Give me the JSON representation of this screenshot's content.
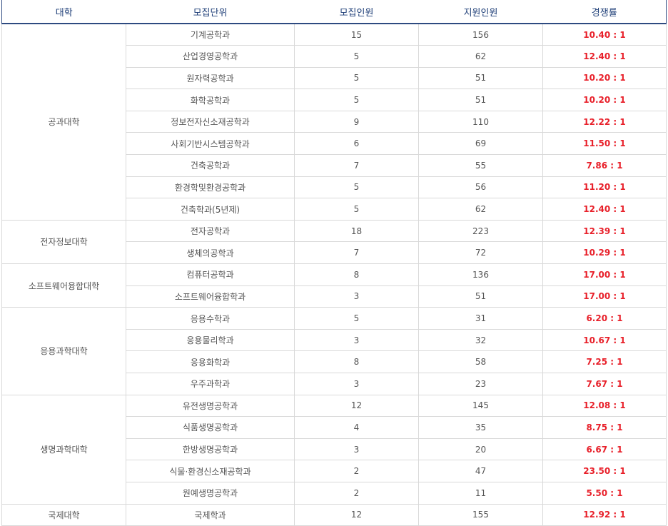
{
  "headers": {
    "college": "대학",
    "unit": "모집단위",
    "quota": "모집인원",
    "applicants": "지원인원",
    "ratio": "경쟁률"
  },
  "colleges": [
    {
      "name": "공과대학",
      "rows": [
        {
          "unit": "기계공학과",
          "quota": "15",
          "applicants": "156",
          "ratio": "10.40 : 1"
        },
        {
          "unit": "산업경영공학과",
          "quota": "5",
          "applicants": "62",
          "ratio": "12.40 : 1"
        },
        {
          "unit": "원자력공학과",
          "quota": "5",
          "applicants": "51",
          "ratio": "10.20 : 1"
        },
        {
          "unit": "화학공학과",
          "quota": "5",
          "applicants": "51",
          "ratio": "10.20 : 1"
        },
        {
          "unit": "정보전자신소재공학과",
          "quota": "9",
          "applicants": "110",
          "ratio": "12.22 : 1"
        },
        {
          "unit": "사회기반시스템공학과",
          "quota": "6",
          "applicants": "69",
          "ratio": "11.50 : 1"
        },
        {
          "unit": "건축공학과",
          "quota": "7",
          "applicants": "55",
          "ratio": "7.86 : 1"
        },
        {
          "unit": "환경학및환경공학과",
          "quota": "5",
          "applicants": "56",
          "ratio": "11.20 : 1"
        },
        {
          "unit": "건축학과(5년제)",
          "quota": "5",
          "applicants": "62",
          "ratio": "12.40 : 1"
        }
      ]
    },
    {
      "name": "전자정보대학",
      "rows": [
        {
          "unit": "전자공학과",
          "quota": "18",
          "applicants": "223",
          "ratio": "12.39 : 1"
        },
        {
          "unit": "생체의공학과",
          "quota": "7",
          "applicants": "72",
          "ratio": "10.29 : 1"
        }
      ]
    },
    {
      "name": "소프트웨어융합대학",
      "rows": [
        {
          "unit": "컴퓨터공학과",
          "quota": "8",
          "applicants": "136",
          "ratio": "17.00 : 1"
        },
        {
          "unit": "소프트웨어융합학과",
          "quota": "3",
          "applicants": "51",
          "ratio": "17.00 : 1"
        }
      ]
    },
    {
      "name": "응용과학대학",
      "rows": [
        {
          "unit": "응용수학과",
          "quota": "5",
          "applicants": "31",
          "ratio": "6.20 : 1"
        },
        {
          "unit": "응용물리학과",
          "quota": "3",
          "applicants": "32",
          "ratio": "10.67 : 1"
        },
        {
          "unit": "응용화학과",
          "quota": "8",
          "applicants": "58",
          "ratio": "7.25 : 1"
        },
        {
          "unit": "우주과학과",
          "quota": "3",
          "applicants": "23",
          "ratio": "7.67 : 1"
        }
      ]
    },
    {
      "name": "생명과학대학",
      "rows": [
        {
          "unit": "유전생명공학과",
          "quota": "12",
          "applicants": "145",
          "ratio": "12.08 : 1"
        },
        {
          "unit": "식품생명공학과",
          "quota": "4",
          "applicants": "35",
          "ratio": "8.75 : 1"
        },
        {
          "unit": "한방생명공학과",
          "quota": "3",
          "applicants": "20",
          "ratio": "6.67 : 1"
        },
        {
          "unit": "식물·환경신소재공학과",
          "quota": "2",
          "applicants": "47",
          "ratio": "23.50 : 1"
        },
        {
          "unit": "원예생명공학과",
          "quota": "2",
          "applicants": "11",
          "ratio": "5.50 : 1"
        }
      ]
    },
    {
      "name": "국제대학",
      "rows": [
        {
          "unit": "국제학과",
          "quota": "12",
          "applicants": "155",
          "ratio": "12.92 : 1"
        }
      ]
    }
  ],
  "colors": {
    "header_text": "#1f3f78",
    "header_border": "#2d4a80",
    "ratio_text": "#e8202a",
    "cell_border": "#d9d9d9",
    "body_text": "#555555"
  }
}
